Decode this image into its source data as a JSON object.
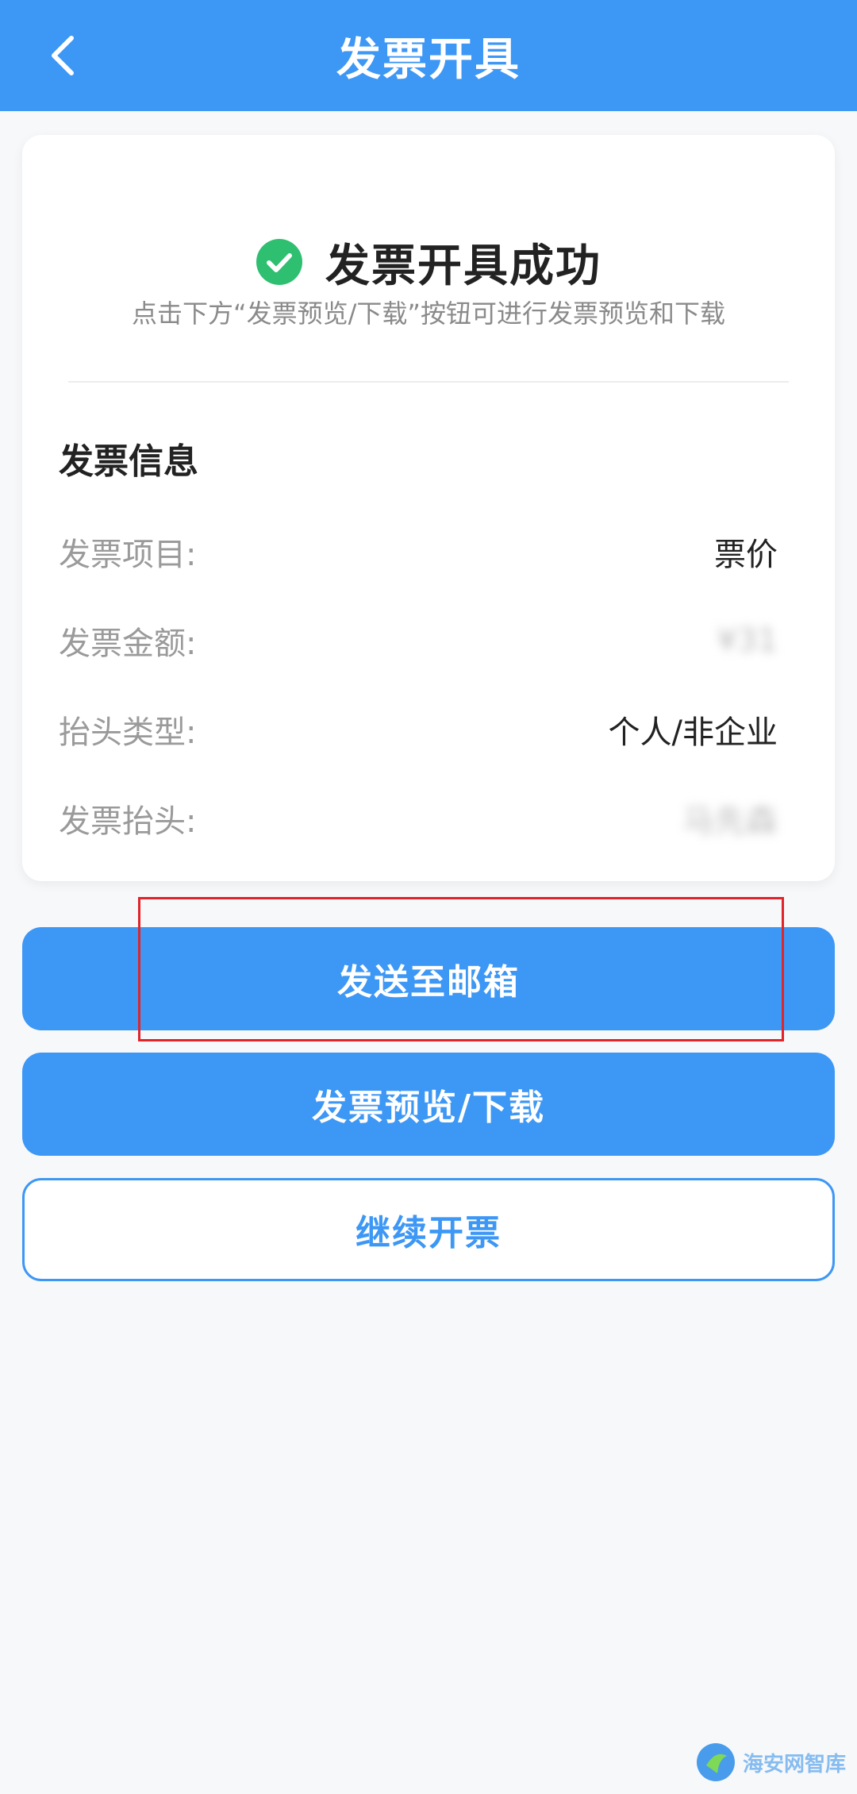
{
  "header": {
    "title": "发票开具",
    "back_icon": "chevron-left-icon"
  },
  "result": {
    "status_icon": "check-circle-icon",
    "title": "发票开具成功",
    "hint": "点击下方“发票预览/下载”按钮可进行发票预览和下载"
  },
  "invoice_info": {
    "section_title": "发票信息",
    "rows": [
      {
        "label": "发票项目:",
        "value": "票价"
      },
      {
        "label": "发票金额:",
        "value": "¥31"
      },
      {
        "label": "抬头类型:",
        "value": "个人/非企业"
      },
      {
        "label": "发票抬头:",
        "value": "马先森"
      }
    ]
  },
  "actions": {
    "send_email": "发送至邮箱",
    "preview_download": "发票预览/下载",
    "continue": "继续开票"
  },
  "watermark": {
    "text": "海安网智库"
  },
  "colors": {
    "primary": "#3d97f5",
    "success": "#2fbf71",
    "highlight": "#e0242a",
    "background": "#f7f8fa"
  }
}
